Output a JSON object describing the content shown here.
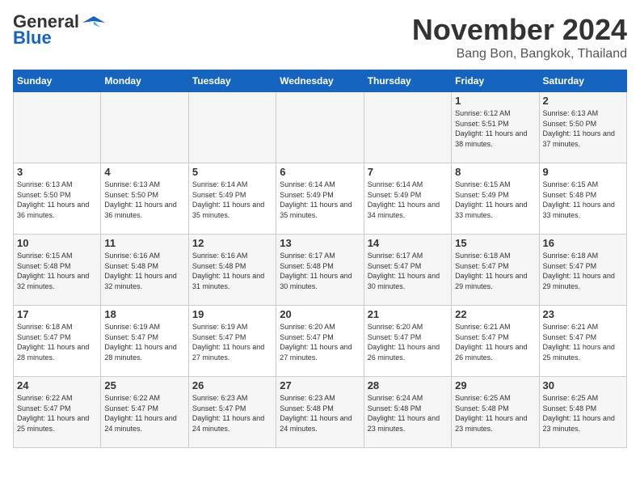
{
  "logo": {
    "line1": "General",
    "line2": "Blue"
  },
  "title": "November 2024",
  "location": "Bang Bon, Bangkok, Thailand",
  "weekdays": [
    "Sunday",
    "Monday",
    "Tuesday",
    "Wednesday",
    "Thursday",
    "Friday",
    "Saturday"
  ],
  "weeks": [
    [
      {
        "day": "",
        "info": ""
      },
      {
        "day": "",
        "info": ""
      },
      {
        "day": "",
        "info": ""
      },
      {
        "day": "",
        "info": ""
      },
      {
        "day": "",
        "info": ""
      },
      {
        "day": "1",
        "info": "Sunrise: 6:12 AM\nSunset: 5:51 PM\nDaylight: 11 hours and 38 minutes."
      },
      {
        "day": "2",
        "info": "Sunrise: 6:13 AM\nSunset: 5:50 PM\nDaylight: 11 hours and 37 minutes."
      }
    ],
    [
      {
        "day": "3",
        "info": "Sunrise: 6:13 AM\nSunset: 5:50 PM\nDaylight: 11 hours and 36 minutes."
      },
      {
        "day": "4",
        "info": "Sunrise: 6:13 AM\nSunset: 5:50 PM\nDaylight: 11 hours and 36 minutes."
      },
      {
        "day": "5",
        "info": "Sunrise: 6:14 AM\nSunset: 5:49 PM\nDaylight: 11 hours and 35 minutes."
      },
      {
        "day": "6",
        "info": "Sunrise: 6:14 AM\nSunset: 5:49 PM\nDaylight: 11 hours and 35 minutes."
      },
      {
        "day": "7",
        "info": "Sunrise: 6:14 AM\nSunset: 5:49 PM\nDaylight: 11 hours and 34 minutes."
      },
      {
        "day": "8",
        "info": "Sunrise: 6:15 AM\nSunset: 5:49 PM\nDaylight: 11 hours and 33 minutes."
      },
      {
        "day": "9",
        "info": "Sunrise: 6:15 AM\nSunset: 5:48 PM\nDaylight: 11 hours and 33 minutes."
      }
    ],
    [
      {
        "day": "10",
        "info": "Sunrise: 6:15 AM\nSunset: 5:48 PM\nDaylight: 11 hours and 32 minutes."
      },
      {
        "day": "11",
        "info": "Sunrise: 6:16 AM\nSunset: 5:48 PM\nDaylight: 11 hours and 32 minutes."
      },
      {
        "day": "12",
        "info": "Sunrise: 6:16 AM\nSunset: 5:48 PM\nDaylight: 11 hours and 31 minutes."
      },
      {
        "day": "13",
        "info": "Sunrise: 6:17 AM\nSunset: 5:48 PM\nDaylight: 11 hours and 30 minutes."
      },
      {
        "day": "14",
        "info": "Sunrise: 6:17 AM\nSunset: 5:47 PM\nDaylight: 11 hours and 30 minutes."
      },
      {
        "day": "15",
        "info": "Sunrise: 6:18 AM\nSunset: 5:47 PM\nDaylight: 11 hours and 29 minutes."
      },
      {
        "day": "16",
        "info": "Sunrise: 6:18 AM\nSunset: 5:47 PM\nDaylight: 11 hours and 29 minutes."
      }
    ],
    [
      {
        "day": "17",
        "info": "Sunrise: 6:18 AM\nSunset: 5:47 PM\nDaylight: 11 hours and 28 minutes."
      },
      {
        "day": "18",
        "info": "Sunrise: 6:19 AM\nSunset: 5:47 PM\nDaylight: 11 hours and 28 minutes."
      },
      {
        "day": "19",
        "info": "Sunrise: 6:19 AM\nSunset: 5:47 PM\nDaylight: 11 hours and 27 minutes."
      },
      {
        "day": "20",
        "info": "Sunrise: 6:20 AM\nSunset: 5:47 PM\nDaylight: 11 hours and 27 minutes."
      },
      {
        "day": "21",
        "info": "Sunrise: 6:20 AM\nSunset: 5:47 PM\nDaylight: 11 hours and 26 minutes."
      },
      {
        "day": "22",
        "info": "Sunrise: 6:21 AM\nSunset: 5:47 PM\nDaylight: 11 hours and 26 minutes."
      },
      {
        "day": "23",
        "info": "Sunrise: 6:21 AM\nSunset: 5:47 PM\nDaylight: 11 hours and 25 minutes."
      }
    ],
    [
      {
        "day": "24",
        "info": "Sunrise: 6:22 AM\nSunset: 5:47 PM\nDaylight: 11 hours and 25 minutes."
      },
      {
        "day": "25",
        "info": "Sunrise: 6:22 AM\nSunset: 5:47 PM\nDaylight: 11 hours and 24 minutes."
      },
      {
        "day": "26",
        "info": "Sunrise: 6:23 AM\nSunset: 5:47 PM\nDaylight: 11 hours and 24 minutes."
      },
      {
        "day": "27",
        "info": "Sunrise: 6:23 AM\nSunset: 5:48 PM\nDaylight: 11 hours and 24 minutes."
      },
      {
        "day": "28",
        "info": "Sunrise: 6:24 AM\nSunset: 5:48 PM\nDaylight: 11 hours and 23 minutes."
      },
      {
        "day": "29",
        "info": "Sunrise: 6:25 AM\nSunset: 5:48 PM\nDaylight: 11 hours and 23 minutes."
      },
      {
        "day": "30",
        "info": "Sunrise: 6:25 AM\nSunset: 5:48 PM\nDaylight: 11 hours and 23 minutes."
      }
    ]
  ]
}
